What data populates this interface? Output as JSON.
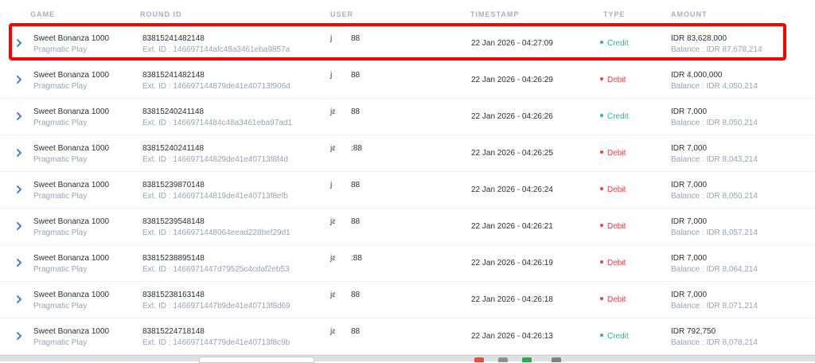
{
  "columns": {
    "game": "GAME",
    "round_id": "ROUND ID",
    "user": "USER",
    "timestamp": "TIMESTAMP",
    "type": "TYPE",
    "amount": "AMOUNT"
  },
  "colors": {
    "credit": "#2bb59b",
    "debit": "#e5424d",
    "highlight": "#ff0000",
    "chevron": "#2f6fd1"
  },
  "rows": [
    {
      "game": "Sweet Bonanza 1000",
      "provider": "Pragmatic Play",
      "round_id": "83815241482148",
      "ext_id": "Ext. ID : 146697144afc48a3461eba9857a",
      "user_a": "j",
      "user_b": "88",
      "timestamp": "22 Jan 2026 - 04:27:09",
      "type": "Credit",
      "amount": "IDR 83,628,000",
      "balance": "Balance : IDR 87,678,214"
    },
    {
      "game": "Sweet Bonanza 1000",
      "provider": "Pragmatic Play",
      "round_id": "83815241482148",
      "ext_id": "Ext. ID : 146697144879de41e40713f906d",
      "user_a": "j",
      "user_b": "88",
      "timestamp": "22 Jan 2026 - 04:26:29",
      "type": "Debit",
      "amount": "IDR 4,000,000",
      "balance": "Balance : IDR 4,050,214"
    },
    {
      "game": "Sweet Bonanza 1000",
      "provider": "Pragmatic Play",
      "round_id": "83815240241148",
      "ext_id": "Ext. ID : 14669714484c48a3461eba97ad1",
      "user_a": "ja",
      "user_b": "88",
      "timestamp": "22 Jan 2026 - 04:26:26",
      "type": "Credit",
      "amount": "IDR 7,000",
      "balance": "Balance : IDR 8,050,214"
    },
    {
      "game": "Sweet Bonanza 1000",
      "provider": "Pragmatic Play",
      "round_id": "83815240241148",
      "ext_id": "Ext. ID : 146697144829de41e40713f8f4d",
      "user_a": "ja",
      "user_b": ":88",
      "timestamp": "22 Jan 2026 - 04:26:25",
      "type": "Debit",
      "amount": "IDR 7,000",
      "balance": "Balance : IDR 8,043,214"
    },
    {
      "game": "Sweet Bonanza 1000",
      "provider": "Pragmatic Play",
      "round_id": "83815239870148",
      "ext_id": "Ext. ID : 146697144819de41e40713f8efb",
      "user_a": "j",
      "user_b": "88",
      "timestamp": "22 Jan 2026 - 04:26:24",
      "type": "Debit",
      "amount": "IDR 7,000",
      "balance": "Balance : IDR 8,050,214"
    },
    {
      "game": "Sweet Bonanza 1000",
      "provider": "Pragmatic Play",
      "round_id": "83815239548148",
      "ext_id": "Ext. ID : 1466971448064eead228bef29d1",
      "user_a": "ja",
      "user_b": "88",
      "timestamp": "22 Jan 2026 - 04:26:21",
      "type": "Debit",
      "amount": "IDR 7,000",
      "balance": "Balance : IDR 8,057,214"
    },
    {
      "game": "Sweet Bonanza 1000",
      "provider": "Pragmatic Play",
      "round_id": "83815238895148",
      "ext_id": "Ext. ID : 1466971447d79525c4cdaf2eb53",
      "user_a": "ja",
      "user_b": ":88",
      "timestamp": "22 Jan 2026 - 04:26:19",
      "type": "Debit",
      "amount": "IDR 7,000",
      "balance": "Balance : IDR 8,064,214"
    },
    {
      "game": "Sweet Bonanza 1000",
      "provider": "Pragmatic Play",
      "round_id": "83815238163148",
      "ext_id": "Ext. ID : 1466971447b9de41e40713f8d69",
      "user_a": "ja",
      "user_b": "88",
      "timestamp": "22 Jan 2026 - 04:26:18",
      "type": "Debit",
      "amount": "IDR 7,000",
      "balance": "Balance : IDR 8,071,214"
    },
    {
      "game": "Sweet Bonanza 1000",
      "provider": "Pragmatic Play",
      "round_id": "83815224718148",
      "ext_id": "Ext. ID : 146697144779de41e40713f8c9b",
      "user_a": "ja",
      "user_b": "88",
      "timestamp": "22 Jan 2026 - 04:26:13",
      "type": "Credit",
      "amount": "IDR 792,750",
      "balance": "Balance : IDR 8,078,214"
    }
  ]
}
